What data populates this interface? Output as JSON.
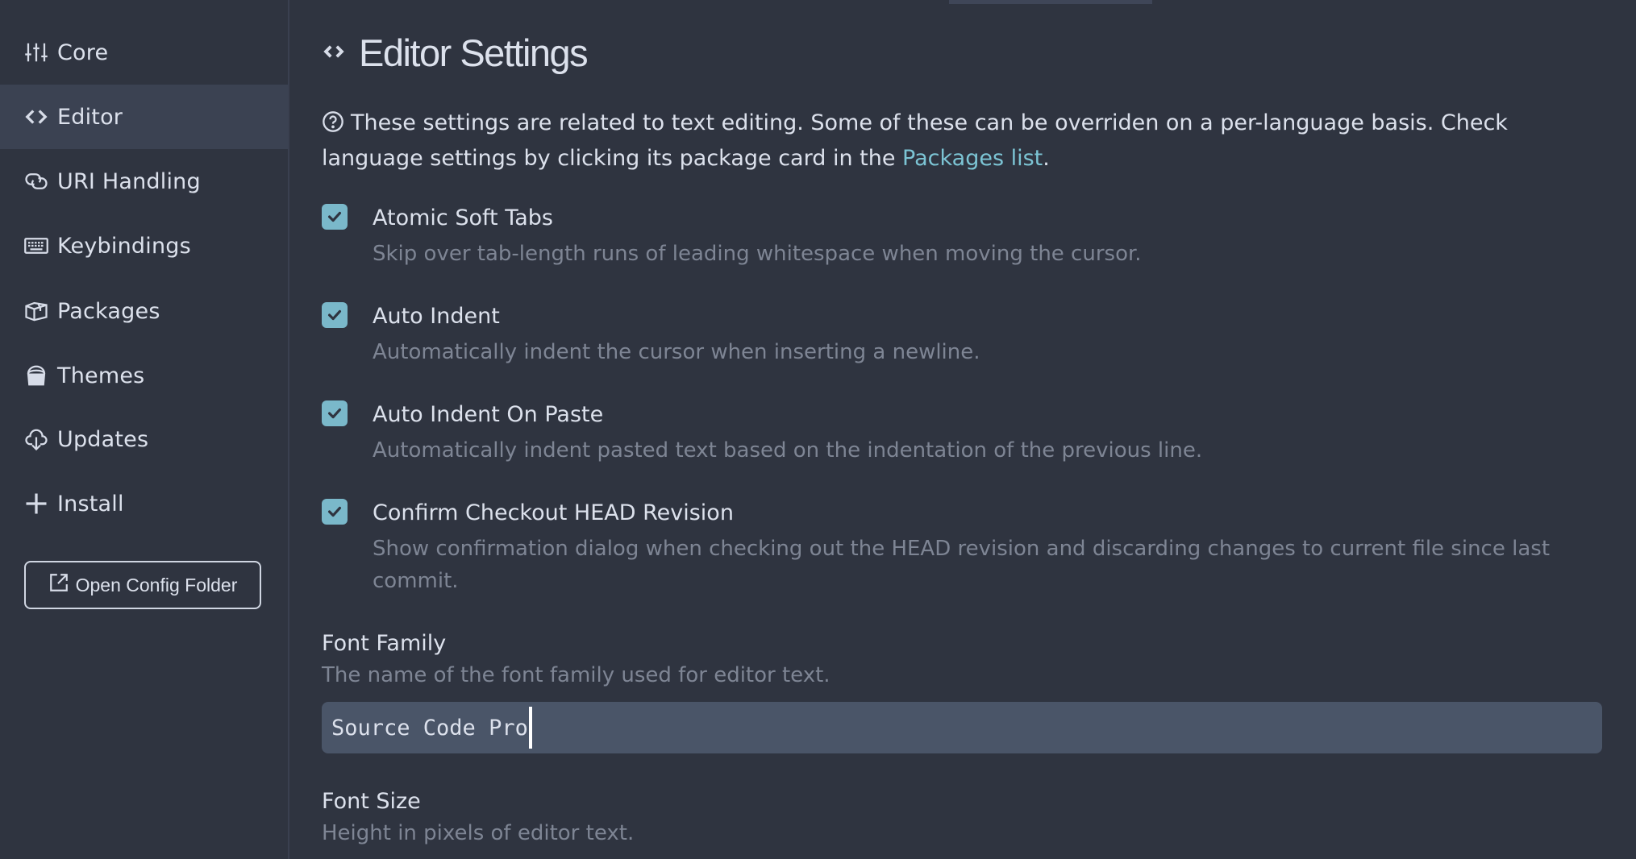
{
  "sidebar": {
    "items": [
      {
        "label": "Core",
        "icon": "sliders-icon",
        "selected": false
      },
      {
        "label": "Editor",
        "icon": "code-icon",
        "selected": true
      },
      {
        "label": "URI Handling",
        "icon": "link-icon",
        "selected": false
      },
      {
        "label": "Keybindings",
        "icon": "keyboard-icon",
        "selected": false
      },
      {
        "label": "Packages",
        "icon": "package-icon",
        "selected": false
      },
      {
        "label": "Themes",
        "icon": "paintcan-icon",
        "selected": false
      },
      {
        "label": "Updates",
        "icon": "cloud-download-icon",
        "selected": false
      },
      {
        "label": "Install",
        "icon": "plus-icon",
        "selected": false
      }
    ],
    "open_config_label": "Open Config Folder"
  },
  "main": {
    "title": "Editor Settings",
    "intro_text": "These settings are related to text editing. Some of these can be overriden on a per-language basis. Check language settings by clicking its package card in the ",
    "intro_link": "Packages list",
    "intro_end": ".",
    "settings": [
      {
        "label": "Atomic Soft Tabs",
        "description": "Skip over tab-length runs of leading whitespace when moving the cursor.",
        "checked": true
      },
      {
        "label": "Auto Indent",
        "description": "Automatically indent the cursor when inserting a newline.",
        "checked": true
      },
      {
        "label": "Auto Indent On Paste",
        "description": "Automatically indent pasted text based on the indentation of the previous line.",
        "checked": true
      },
      {
        "label": "Confirm Checkout HEAD Revision",
        "description": "Show confirmation dialog when checking out the HEAD revision and discarding changes to current file since last commit.",
        "checked": true
      }
    ],
    "font_family": {
      "label": "Font Family",
      "description": "The name of the font family used for editor text.",
      "value": "Source Code Pro"
    },
    "font_size": {
      "label": "Font Size",
      "description": "Height in pixels of editor text."
    }
  },
  "colors": {
    "background": "#2f3440",
    "selected_row": "#3b4252",
    "accent": "#7ab8ca",
    "link": "#7cc4d4",
    "input_bg": "#4a5568",
    "muted_text": "#7e8594"
  }
}
